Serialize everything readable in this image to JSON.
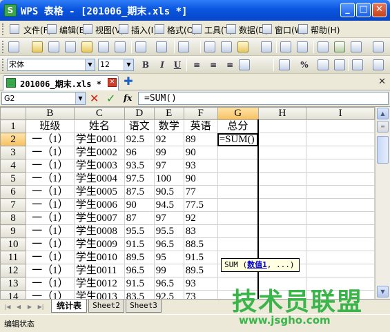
{
  "window": {
    "title": "WPS 表格 - [201006_期末.xls *]",
    "app_icon": "S"
  },
  "menu": [
    "文件(F)",
    "编辑(E)",
    "视图(V)",
    "插入(I)",
    "格式(O)",
    "工具(T)",
    "数据(D)",
    "窗口(W)",
    "帮助(H)"
  ],
  "format": {
    "font": "宋体",
    "size": "12"
  },
  "doc_tab": {
    "label": "201006_期末.xls *"
  },
  "formula_bar": {
    "cell_ref": "G2",
    "fx": "fx",
    "formula": "=SUM()"
  },
  "columns": [
    "B",
    "C",
    "D",
    "E",
    "F",
    "G",
    "H",
    "I"
  ],
  "header_row": {
    "num": "1",
    "cells": [
      "班级",
      "姓名",
      "语文",
      "数学",
      "英语",
      "总分",
      "",
      ""
    ]
  },
  "rows": [
    {
      "num": "2",
      "cells": [
        "一（1）",
        "学生0001",
        "92.5",
        "92",
        "89",
        "=SUM()",
        "",
        ""
      ]
    },
    {
      "num": "3",
      "cells": [
        "一（1）",
        "学生0002",
        "96",
        "99",
        "90",
        "",
        "",
        ""
      ]
    },
    {
      "num": "4",
      "cells": [
        "一（1）",
        "学生0003",
        "93.5",
        "97",
        "93",
        "",
        "",
        ""
      ]
    },
    {
      "num": "5",
      "cells": [
        "一（1）",
        "学生0004",
        "97.5",
        "100",
        "90",
        "",
        "",
        ""
      ]
    },
    {
      "num": "6",
      "cells": [
        "一（1）",
        "学生0005",
        "87.5",
        "90.5",
        "77",
        "",
        "",
        ""
      ]
    },
    {
      "num": "7",
      "cells": [
        "一（1）",
        "学生0006",
        "90",
        "94.5",
        "77.5",
        "",
        "",
        ""
      ]
    },
    {
      "num": "8",
      "cells": [
        "一（1）",
        "学生0007",
        "87",
        "97",
        "92",
        "",
        "",
        ""
      ]
    },
    {
      "num": "9",
      "cells": [
        "一（1）",
        "学生0008",
        "95.5",
        "95.5",
        "83",
        "",
        "",
        ""
      ]
    },
    {
      "num": "10",
      "cells": [
        "一（1）",
        "学生0009",
        "91.5",
        "96.5",
        "88.5",
        "",
        "",
        ""
      ]
    },
    {
      "num": "11",
      "cells": [
        "一（1）",
        "学生0010",
        "89.5",
        "95",
        "91.5",
        "",
        "",
        ""
      ]
    },
    {
      "num": "12",
      "cells": [
        "一（1）",
        "学生0011",
        "96.5",
        "99",
        "89.5",
        "",
        "",
        ""
      ]
    },
    {
      "num": "13",
      "cells": [
        "一（1）",
        "学生0012",
        "91.5",
        "96.5",
        "93",
        "",
        "",
        ""
      ]
    },
    {
      "num": "14",
      "cells": [
        "一（1）",
        "学生0013",
        "83.5",
        "92.5",
        "73",
        "",
        "",
        ""
      ]
    }
  ],
  "tooltip": {
    "fn": "SUM (",
    "arg": "数值1",
    "rest": ", ...)"
  },
  "sheet_tabs": [
    "统计表",
    "Sheet2",
    "Sheet3"
  ],
  "status": "编辑状态",
  "watermark": {
    "main": "技术员联盟",
    "url": "www.jsgho.com"
  },
  "colors": {
    "title_bar": "#0a56e0",
    "active_header": "#f6c060",
    "watermark": "#39b54a"
  }
}
